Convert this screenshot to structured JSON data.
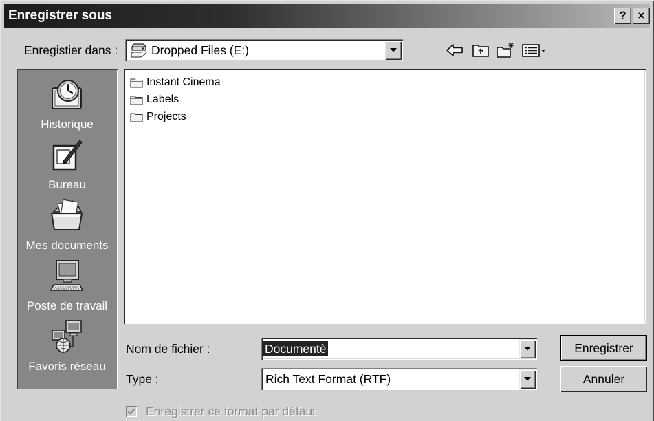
{
  "window": {
    "title": "Enregistrer sous",
    "help_button": "?",
    "close_button": "×"
  },
  "location": {
    "label": "Enregistier dans :",
    "value": "Dropped Files (E:)",
    "icon": "shared-drive-icon"
  },
  "toolbar": {
    "icons": [
      "back-arrow-icon",
      "up-folder-icon",
      "new-folder-icon",
      "view-menu-icon"
    ]
  },
  "places": [
    {
      "label": "Historique",
      "icon": "history-icon"
    },
    {
      "label": "Bureau",
      "icon": "desktop-icon"
    },
    {
      "label": "Mes documents",
      "icon": "my-documents-icon"
    },
    {
      "label": "Poste de travail",
      "icon": "my-computer-icon"
    },
    {
      "label": "Favoris réseau",
      "icon": "network-places-icon"
    }
  ],
  "files": [
    {
      "name": "Instant Cinema",
      "icon": "folder-icon"
    },
    {
      "name": "Labels",
      "icon": "folder-icon"
    },
    {
      "name": "Projects",
      "icon": "folder-icon"
    }
  ],
  "filename": {
    "label": "Nom de fichier :",
    "value": "Documentè",
    "selected": true
  },
  "filetype": {
    "label": "Type :",
    "value": "Rich Text Format (RTF)"
  },
  "actions": {
    "save": "Enregistrer",
    "cancel": "Annuler"
  },
  "default_format": {
    "label": "Enregistrer ce format par défaut",
    "checked": true,
    "enabled": false
  },
  "colors": {
    "title_bar_dark": "#1c1c1c",
    "title_bar_light": "#b8b8b8",
    "face": "#d2d2d2",
    "places_bar": "#878787",
    "selection": "#242424"
  }
}
